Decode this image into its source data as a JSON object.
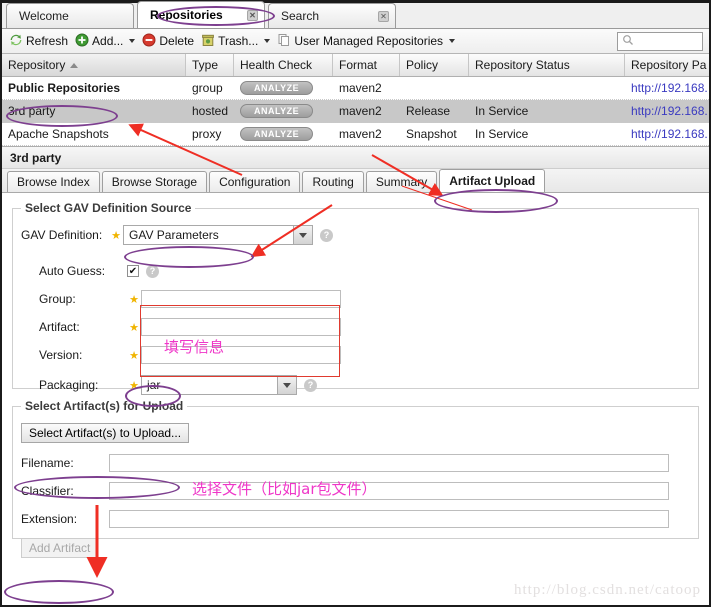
{
  "window": {
    "top_tabs": [
      {
        "label": "Welcome",
        "active": false,
        "closable": false
      },
      {
        "label": "Repositories",
        "active": true,
        "closable": true
      },
      {
        "label": "Search",
        "active": false,
        "closable": true
      }
    ]
  },
  "toolbar": {
    "refresh": "Refresh",
    "add": "Add...",
    "delete": "Delete",
    "trash": "Trash...",
    "user_managed": "User Managed Repositories",
    "search_placeholder": ""
  },
  "table": {
    "columns": [
      {
        "label": "Repository",
        "sorted": true,
        "sort_dir": "asc"
      },
      {
        "label": "Type",
        "sorted": false
      },
      {
        "label": "Health Check",
        "sorted": false
      },
      {
        "label": "Format",
        "sorted": false
      },
      {
        "label": "Policy",
        "sorted": false
      },
      {
        "label": "Repository Status",
        "sorted": false
      },
      {
        "label": "Repository Pa",
        "sorted": false
      }
    ],
    "rows": [
      {
        "repository": "Public Repositories",
        "type": "group",
        "health": "ANALYZE",
        "format": "maven2",
        "policy": "",
        "status": "",
        "path": "http://192.168.",
        "selected": false,
        "bold": true
      },
      {
        "repository": "3rd party",
        "type": "hosted",
        "health": "ANALYZE",
        "format": "maven2",
        "policy": "Release",
        "status": "In Service",
        "path": "http://192.168.",
        "selected": true,
        "bold": false
      },
      {
        "repository": "Apache Snapshots",
        "type": "proxy",
        "health": "ANALYZE",
        "format": "maven2",
        "policy": "Snapshot",
        "status": "In Service",
        "path": "http://192.168.",
        "selected": false,
        "bold": false
      }
    ]
  },
  "detail": {
    "title": "3rd party",
    "tabs": [
      {
        "label": "Browse Index",
        "active": false
      },
      {
        "label": "Browse Storage",
        "active": false
      },
      {
        "label": "Configuration",
        "active": false
      },
      {
        "label": "Routing",
        "active": false
      },
      {
        "label": "Summary",
        "active": false
      },
      {
        "label": "Artifact Upload",
        "active": true
      }
    ]
  },
  "gav_section": {
    "legend": "Select GAV Definition Source",
    "gav_definition_label": "GAV Definition:",
    "gav_definition_value": "GAV Parameters",
    "auto_guess_label": "Auto Guess:",
    "auto_guess_checked": true,
    "fields": [
      {
        "label": "Group:",
        "value": "",
        "required": true
      },
      {
        "label": "Artifact:",
        "value": "",
        "required": true
      },
      {
        "label": "Version:",
        "value": "",
        "required": true
      }
    ],
    "packaging_label": "Packaging:",
    "packaging_value": "jar",
    "help_glyph": "?"
  },
  "artifact_section": {
    "legend": "Select Artifact(s) for Upload",
    "select_button": "Select Artifact(s) to Upload...",
    "fields": [
      {
        "label": "Filename:",
        "value": ""
      },
      {
        "label": "Classifier:",
        "value": ""
      },
      {
        "label": "Extension:",
        "value": ""
      }
    ],
    "add_button": "Add Artifact",
    "add_button_disabled": true
  },
  "annotations": {
    "note_fill_info": "填写信息",
    "note_select_file": "选择文件（比如jar包文件）",
    "ellipse_color": "#7d3f8f",
    "arrow_color": "#ef2e24",
    "note_color": "#ef36c8"
  },
  "watermark": "http://blog.csdn.net/catoop"
}
